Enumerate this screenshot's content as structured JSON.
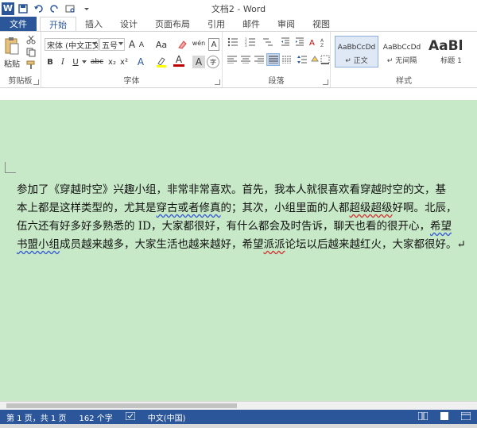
{
  "title": "文档2 - Word",
  "tabs": [
    "文件",
    "开始",
    "插入",
    "设计",
    "页面布局",
    "引用",
    "邮件",
    "审阅",
    "视图"
  ],
  "ribbon": {
    "clipboard": {
      "label": "剪贴板",
      "paste": "粘贴"
    },
    "font": {
      "label": "字体",
      "font_name": "宋体 (中文正文)",
      "font_size": "五号",
      "grow": "A",
      "shrink": "A",
      "aa": "Aa",
      "wen": "wén",
      "bold": "B",
      "italic": "I",
      "underline": "U",
      "strike": "abc",
      "sub": "x₂",
      "sup": "x²",
      "fx_a": "A",
      "color_a": "A",
      "color_a2": "A"
    },
    "paragraph": {
      "label": "段落"
    },
    "styles": {
      "label": "样式",
      "items": [
        {
          "sample": "AaBbCcDd",
          "name": "↵ 正文"
        },
        {
          "sample": "AaBbCcDd",
          "name": "↵ 无间隔"
        },
        {
          "sample": "AaBl",
          "name": "标题 1"
        }
      ]
    }
  },
  "document": {
    "lines": [
      [
        {
          "t": "参加了《穿越时空》兴趣小组，非常非常喜欢。首先，我本人就很喜欢看穿越时空的文，基"
        }
      ],
      [
        {
          "t": "本上都是这样类型的，尤其是"
        },
        {
          "t": "穿古或者修真",
          "s": "wavy"
        },
        {
          "t": "的；其次，小组里面的人都"
        },
        {
          "t": "超级超级",
          "s": "red"
        },
        {
          "t": "好啊。北辰，"
        }
      ],
      [
        {
          "t": "伍六还有好多好多熟悉的 ID，大家都很好，有什么都会及时告诉，聊天也看的很开心，"
        },
        {
          "t": "希望",
          "s": "wavy"
        }
      ],
      [
        {
          "t": "书盟小组",
          "s": "wavy"
        },
        {
          "t": "成员越来越多，大家生活也越来越好，希望"
        },
        {
          "t": "派派",
          "s": "red"
        },
        {
          "t": "论坛以后越来越红火，大家都很好。↵"
        }
      ]
    ]
  },
  "status": {
    "page": "第 1 页，共 1 页",
    "words": "162 个字",
    "lang": "中文(中国)"
  }
}
